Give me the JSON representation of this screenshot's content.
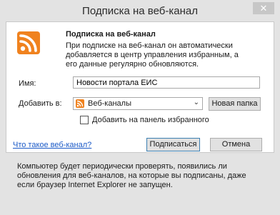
{
  "window": {
    "title": "Подписка на веб-канал",
    "close_glyph": "✕"
  },
  "panel": {
    "header": "Подписка на веб-канал",
    "description": "При подписке на веб-канал он автоматически добавляется в центр управления избранным, а его данные регулярно обновляются.",
    "name_label": "Имя:",
    "name_value": "Новости портала ЕИС",
    "add_to_label": "Добавить в:",
    "folder_selected": "Веб-каналы",
    "new_folder_button": "Новая папка",
    "favorites_bar_checkbox_label": "Добавить на панель избранного",
    "favorites_bar_checked": false,
    "help_link": "Что такое веб-канал?",
    "subscribe_button": "Подписаться",
    "cancel_button": "Отмена"
  },
  "footer_info": "Компьютер будет периодически проверять, появились ли обновления для веб-каналов, на которые вы подписаны, даже если браузер Internet Explorer не запущен.",
  "icons": {
    "feed_icon": "rss-icon",
    "dropdown_icon": "chevron-down-icon"
  },
  "colors": {
    "rss_orange": "#f0821e",
    "link_blue": "#1a59c7",
    "window_bg": "#e3e3e3"
  }
}
